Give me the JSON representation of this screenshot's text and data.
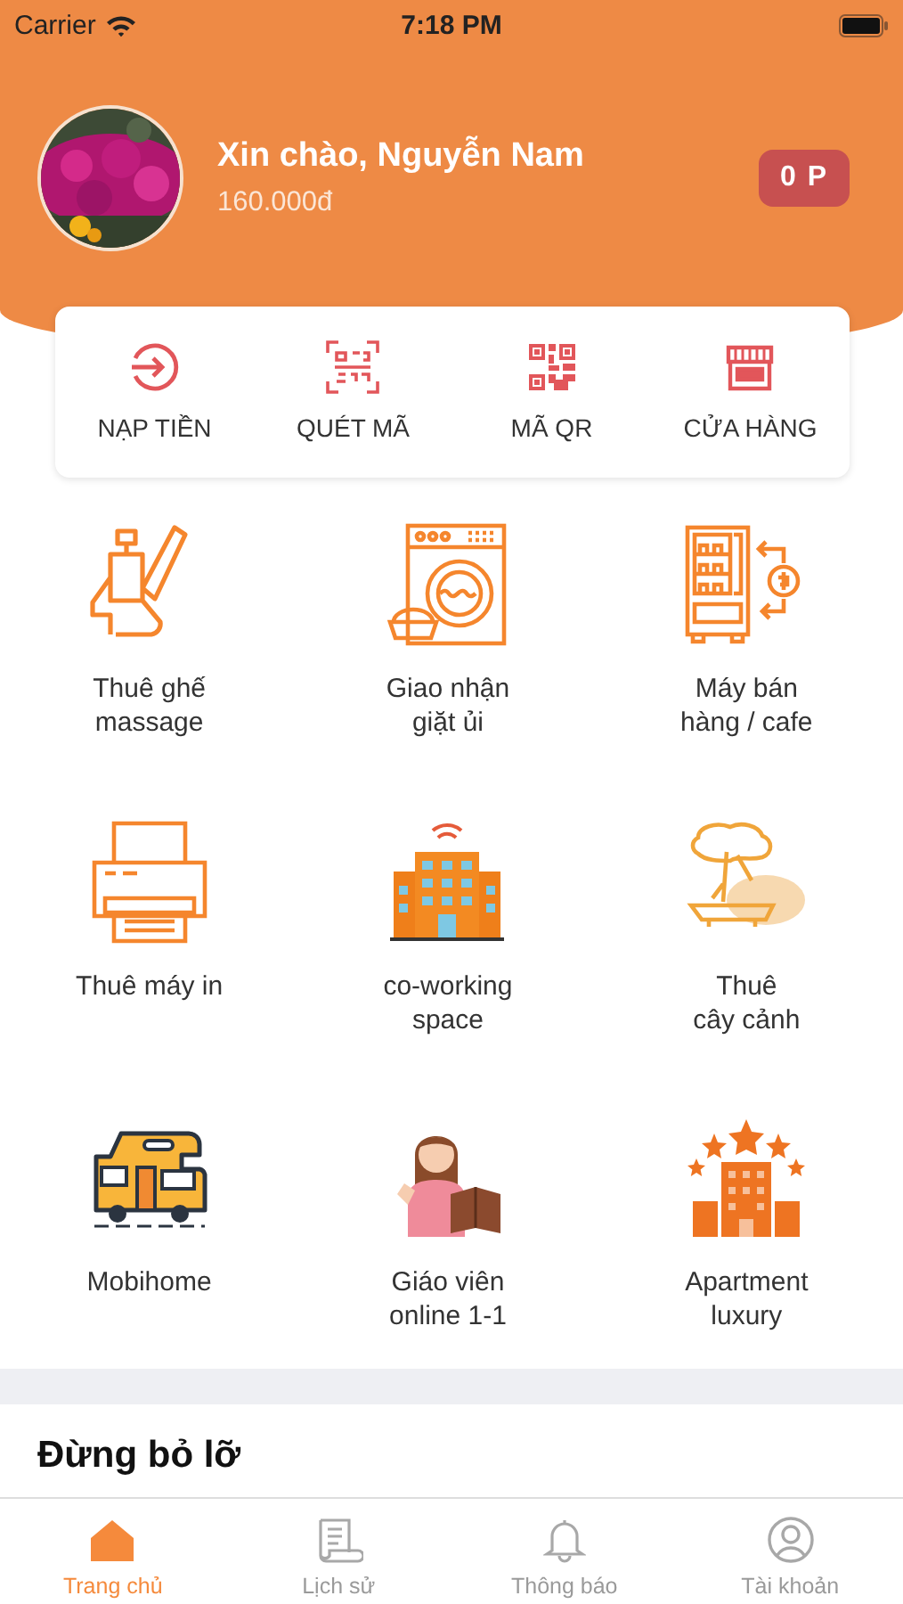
{
  "status_bar": {
    "carrier": "Carrier",
    "time": "7:18 PM"
  },
  "profile": {
    "greeting": "Xin chào, Nguyễn Nam",
    "balance": "160.000đ",
    "points": "0 P"
  },
  "quick_actions": [
    {
      "label": "NẠP TIỀN"
    },
    {
      "label": "QUÉT MÃ"
    },
    {
      "label": "MÃ QR"
    },
    {
      "label": "CỬA HÀNG"
    }
  ],
  "services": [
    {
      "label": "Thuê ghế\nmassage"
    },
    {
      "label": "Giao nhận\ngiặt ủi"
    },
    {
      "label": "Máy bán\nhàng / cafe"
    },
    {
      "label": "Thuê máy in"
    },
    {
      "label": "co-working\nspace"
    },
    {
      "label": "Thuê\ncây cảnh"
    },
    {
      "label": "Mobihome"
    },
    {
      "label": "Giáo viên\nonline 1-1"
    },
    {
      "label": "Apartment\nluxury"
    }
  ],
  "section": {
    "title": "Đừng bỏ lỡ"
  },
  "tab_bar": [
    {
      "label": "Trang chủ",
      "selected": true
    },
    {
      "label": "Lịch sử",
      "selected": false
    },
    {
      "label": "Thông báo",
      "selected": false
    },
    {
      "label": "Tài khoản",
      "selected": false
    }
  ]
}
